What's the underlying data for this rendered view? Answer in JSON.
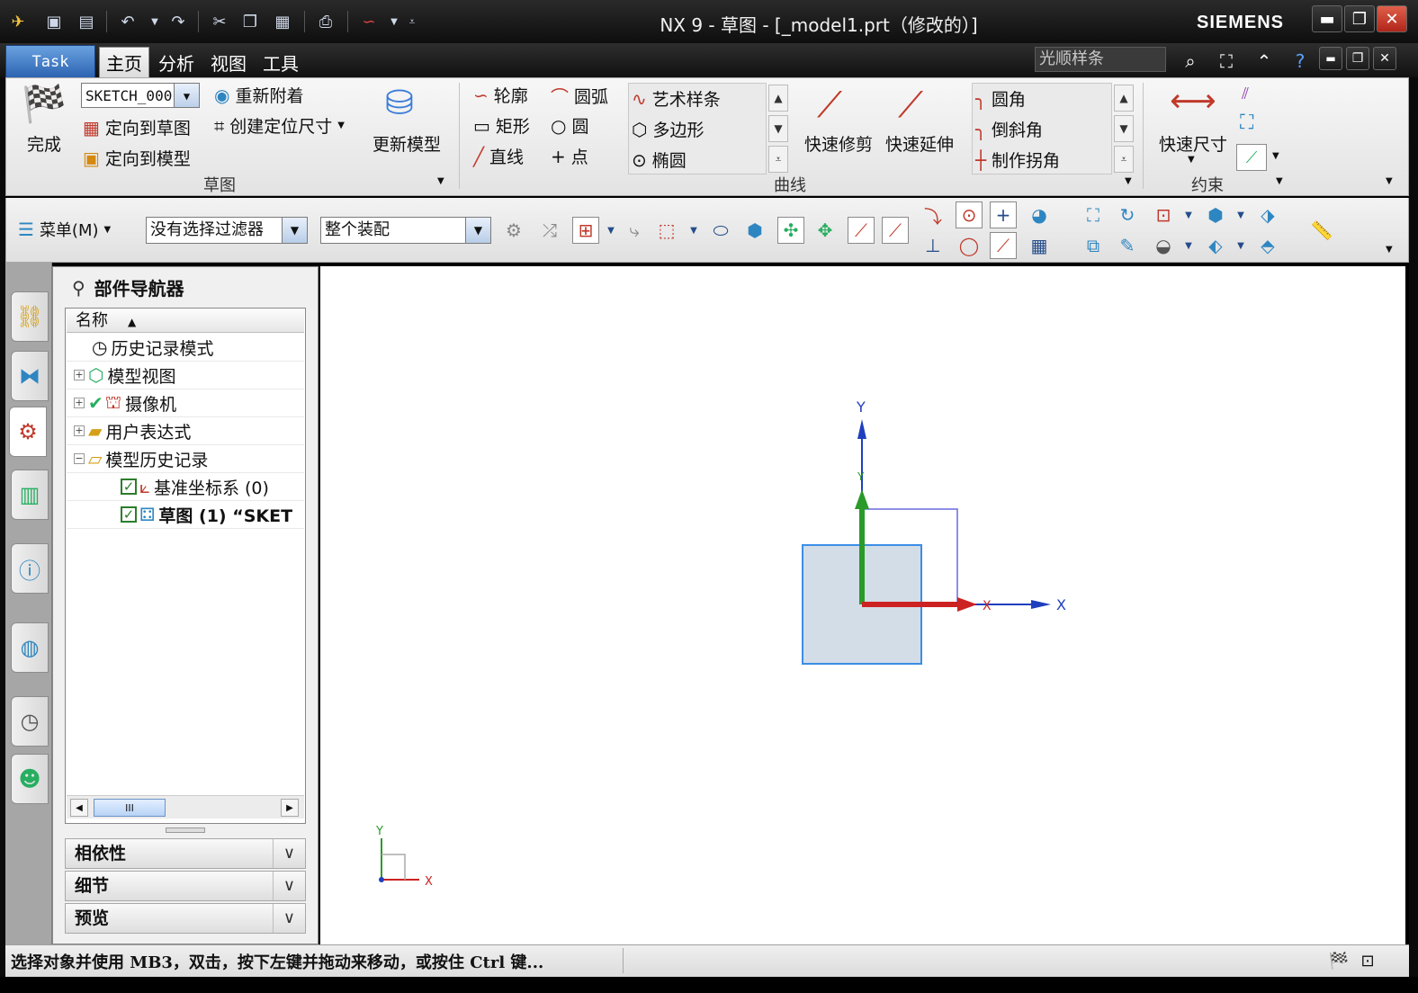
{
  "window": {
    "title": "NX 9 - 草图 - [_model1.prt（修改的）]",
    "brand": "SIEMENS",
    "controls": {
      "minimize": "▬",
      "maximize": "❐",
      "close": "✕"
    }
  },
  "quick_access": {
    "icons": [
      "app-logo-icon",
      "save-icon",
      "save-all-icon",
      "undo-icon",
      "redo-icon",
      "cut-icon",
      "copy-icon",
      "paste-icon",
      "print-icon",
      "sketch-menu-icon"
    ]
  },
  "menu": {
    "task_tab": "Task",
    "tabs": [
      "主页",
      "分析",
      "视图",
      "工具"
    ],
    "search_placeholder": "光顺样条",
    "right_icons": [
      "search-icon",
      "fit-icon",
      "collapse-ribbon-icon",
      "help-icon"
    ],
    "inner_controls": {
      "minimize": "▬",
      "restore": "❐",
      "close": "✕"
    }
  },
  "ribbon": {
    "finish_label": "完成",
    "sketch_name": "SKETCH_000",
    "reattach": "重新附着",
    "orient_sketch": "定向到草图",
    "orient_model": "定向到模型",
    "create_dim": "创建定位尺寸",
    "update_model": "更新模型",
    "group_sketch": "草图",
    "profile": "轮廓",
    "arc": "圆弧",
    "rectangle": "矩形",
    "circle": "圆",
    "line": "直线",
    "point": "点",
    "studio_spline": "艺术样条",
    "polygon": "多边形",
    "ellipse": "椭圆",
    "quick_trim": "快速修剪",
    "quick_extend": "快速延伸",
    "fillet": "圆角",
    "chamfer": "倒斜角",
    "make_corner": "制作拐角",
    "group_curve": "曲线",
    "rapid_dim": "快速尺寸",
    "group_constraint": "约束"
  },
  "toolbar": {
    "menu_label": "菜单(M)",
    "filter": "没有选择过滤器",
    "scope": "整个装配"
  },
  "navigator": {
    "title": "部件导航器",
    "column": "名称",
    "items": [
      {
        "label": "历史记录模式"
      },
      {
        "label": "模型视图"
      },
      {
        "label": "摄像机"
      },
      {
        "label": "用户表达式"
      },
      {
        "label": "模型历史记录"
      },
      {
        "label": "基准坐标系 (0)"
      },
      {
        "label": "草图 (1) “SKET"
      }
    ],
    "scroll_thumb": "III",
    "sections": [
      "相依性",
      "细节",
      "预览"
    ]
  },
  "canvas": {
    "axis_y_top": "Y",
    "axis_x_right": "X",
    "axis_x_mid": "X",
    "axis_y_mid": "Y",
    "triad_x": "X",
    "triad_y": "Y"
  },
  "status": {
    "text": "选择对象并使用 MB3，双击，按下左键并拖动来移动，或按住 Ctrl 键..."
  },
  "colors": {
    "accent_blue": "#2d64b2",
    "square_fill": "#d3dde8",
    "square_stroke": "#3a8ee6",
    "axis_red": "#cc2222",
    "axis_green": "#2a9a2a",
    "axis_blue": "#1f3fbf"
  }
}
